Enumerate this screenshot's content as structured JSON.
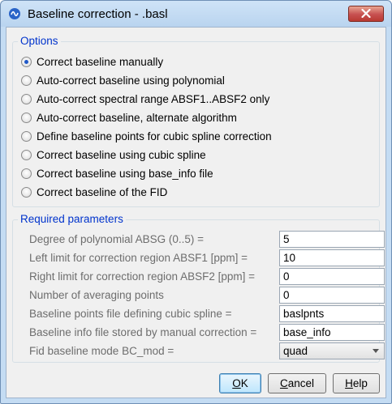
{
  "window": {
    "title": "Baseline correction - .basl"
  },
  "options": {
    "title": "Options",
    "items": [
      {
        "label": "Correct baseline manually",
        "checked": true
      },
      {
        "label": "Auto-correct baseline using polynomial",
        "checked": false
      },
      {
        "label": "Auto-correct spectral range ABSF1..ABSF2 only",
        "checked": false
      },
      {
        "label": "Auto-correct baseline, alternate algorithm",
        "checked": false
      },
      {
        "label": "Define baseline points for cubic spline correction",
        "checked": false
      },
      {
        "label": "Correct baseline using cubic spline",
        "checked": false
      },
      {
        "label": "Correct baseline using base_info file",
        "checked": false
      },
      {
        "label": "Correct baseline of the FID",
        "checked": false
      }
    ]
  },
  "params": {
    "title": "Required parameters",
    "rows": [
      {
        "label": "Degree of polynomial ABSG (0..5) =",
        "value": "5"
      },
      {
        "label": "Left limit for correction region ABSF1 [ppm] =",
        "value": "10"
      },
      {
        "label": "Right limit for correction region ABSF2 [ppm] =",
        "value": "0"
      },
      {
        "label": "Number of averaging points",
        "value": "0"
      },
      {
        "label": "Baseline points file defining cubic spline =",
        "value": "baslpnts"
      },
      {
        "label": "Baseline info file stored by manual correction =",
        "value": "base_info"
      },
      {
        "label": "Fid baseline mode BC_mod =",
        "value": "quad"
      }
    ]
  },
  "buttons": {
    "ok": {
      "pre": "",
      "mnemonic": "O",
      "post": "K"
    },
    "cancel": {
      "pre": "",
      "mnemonic": "C",
      "post": "ancel"
    },
    "help": {
      "pre": "",
      "mnemonic": "H",
      "post": "elp"
    }
  }
}
